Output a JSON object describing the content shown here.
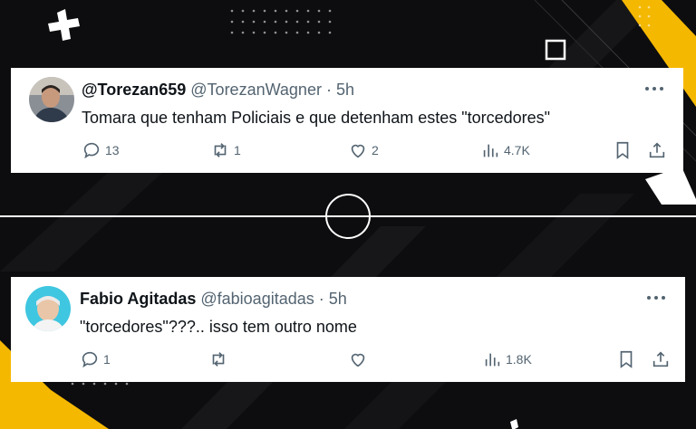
{
  "tweets": [
    {
      "display_name": "@Torezan659",
      "handle": "@TorezanWagner",
      "time": "· 5h",
      "text": "Tomara que tenham Policiais e que detenham estes \"torcedores\"",
      "replies": "13",
      "retweets": "1",
      "likes": "2",
      "views": "4.7K"
    },
    {
      "display_name": "Fabio Agitadas",
      "handle": "@fabioagitadas",
      "time": "· 5h",
      "text": "\"torcedores\"???.. isso tem outro nome",
      "replies": "1",
      "retweets": "",
      "likes": "",
      "views": "1.8K"
    }
  ],
  "colors": {
    "background": "#0d0d0f",
    "accent_yellow": "#f5b800",
    "text": "#0f1419",
    "muted": "#536471"
  },
  "icons": [
    "reply-icon",
    "retweet-icon",
    "like-icon",
    "views-icon",
    "bookmark-icon",
    "share-icon",
    "more-icon"
  ]
}
